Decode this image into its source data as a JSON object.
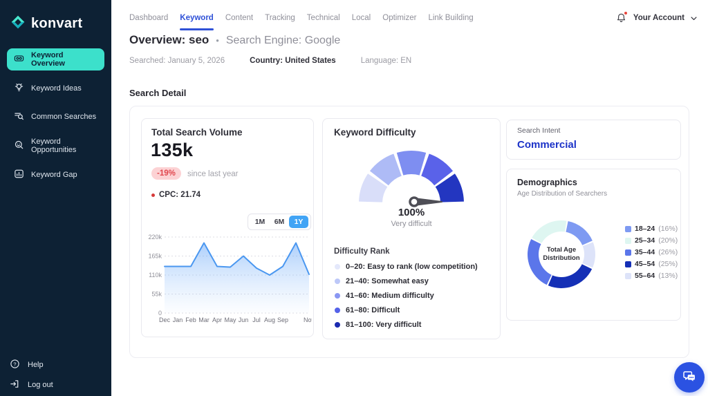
{
  "brand": {
    "name": "konvart",
    "teal": "#3ce0cb",
    "sidebar_bg": "#0d2134"
  },
  "sidebar": {
    "items": [
      {
        "label": "Keyword Overview",
        "active": true
      },
      {
        "label": "Keyword Ideas",
        "active": false
      },
      {
        "label": "Common Searches",
        "active": false
      },
      {
        "label": "Keyword Opportunities",
        "active": false
      },
      {
        "label": "Keyword Gap",
        "active": false
      }
    ],
    "footer_items": [
      {
        "label": "Help"
      },
      {
        "label": "Log out"
      }
    ]
  },
  "header": {
    "tabs": [
      "Dashboard",
      "Keyword",
      "Content",
      "Tracking",
      "Technical",
      "Local",
      "Optimizer",
      "Link Building"
    ],
    "active_tab": "Keyword",
    "account_label": "Your Account",
    "active_color": "#2f51d7"
  },
  "page": {
    "title": "Overview: seo",
    "separator": "•",
    "subtitle": "Search Engine: Google",
    "meta": {
      "searched": "Searched: January 5, 2026",
      "country": "Country: United States",
      "language": "Language: EN"
    },
    "section_title": "Search Detail"
  },
  "volume_card": {
    "title": "Total Search Volume",
    "value": "135k",
    "change": "-19%",
    "change_note": "since last year",
    "cpc": "CPC: 21.74",
    "range_options": [
      "1M",
      "6M",
      "1Y"
    ],
    "active_range": "1Y"
  },
  "difficulty_card": {
    "title": "Keyword Difficulty",
    "score": "100%",
    "score_label": "Very difficult",
    "rank_title": "Difficulty Rank",
    "ranks": [
      {
        "label": "0–20: Easy to rank (low competition)",
        "color": "#e4e8fb"
      },
      {
        "label": "21–40: Somewhat easy",
        "color": "#bdc8f8"
      },
      {
        "label": "41–60: Medium difficulty",
        "color": "#8a97f3"
      },
      {
        "label": "61–80: Difficult",
        "color": "#5462e9"
      },
      {
        "label": "81–100: Very difficult",
        "color": "#1b2ab0"
      }
    ]
  },
  "intent_card": {
    "title": "Search Intent",
    "value": "Commercial"
  },
  "demographics_card": {
    "title": "Demographics",
    "subtitle": "Age Distribution of Searchers",
    "center_line1": "Total Age",
    "center_line2": "Distribution"
  },
  "chat": {
    "color": "#2b52e2"
  },
  "chart_data": [
    {
      "name": "search-volume-trend",
      "type": "area",
      "x_labels": [
        "Dec",
        "Jan",
        "Feb",
        "Mar",
        "Apr",
        "May",
        "Jun",
        "Jul",
        "Aug",
        "Sep",
        "",
        "Nov"
      ],
      "values": [
        135000,
        135000,
        135000,
        203000,
        135000,
        133000,
        165000,
        130000,
        110000,
        135000,
        203000,
        112000
      ],
      "ylim": [
        0,
        220000
      ],
      "y_ticks": [
        "220k",
        "165k",
        "110k",
        "55k",
        "0"
      ],
      "grid": "dashed-horizontal",
      "line_color": "#4a97f0",
      "fill_top": "rgba(106,168,248,0.55)",
      "fill_bottom": "rgba(166,205,252,0.03)"
    },
    {
      "name": "difficulty-gauge",
      "type": "gauge",
      "value_pct": 100,
      "segment_colors": [
        "#d9def9",
        "#aebbf6",
        "#7e8ef1",
        "#5a62e9",
        "#2336c0"
      ],
      "needle_color": "#4e4e56"
    },
    {
      "name": "age-distribution-donut",
      "type": "pie",
      "slices": [
        {
          "label": "18–24",
          "pct": 16,
          "pct_label": "(16%)",
          "color": "#7e9af2"
        },
        {
          "label": "25–34",
          "pct": 20,
          "pct_label": "(20%)",
          "color": "#def6f1"
        },
        {
          "label": "35–44",
          "pct": 26,
          "pct_label": "(26%)",
          "color": "#5b76ea"
        },
        {
          "label": "45–54",
          "pct": 25,
          "pct_label": "(25%)",
          "color": "#1530b6"
        },
        {
          "label": "55–64",
          "pct": 13,
          "pct_label": "(13%)",
          "color": "#dde3f9"
        }
      ],
      "draw_order": [
        1,
        0,
        4,
        3,
        2
      ],
      "start_angle": -62,
      "legend_position": "right"
    }
  ]
}
